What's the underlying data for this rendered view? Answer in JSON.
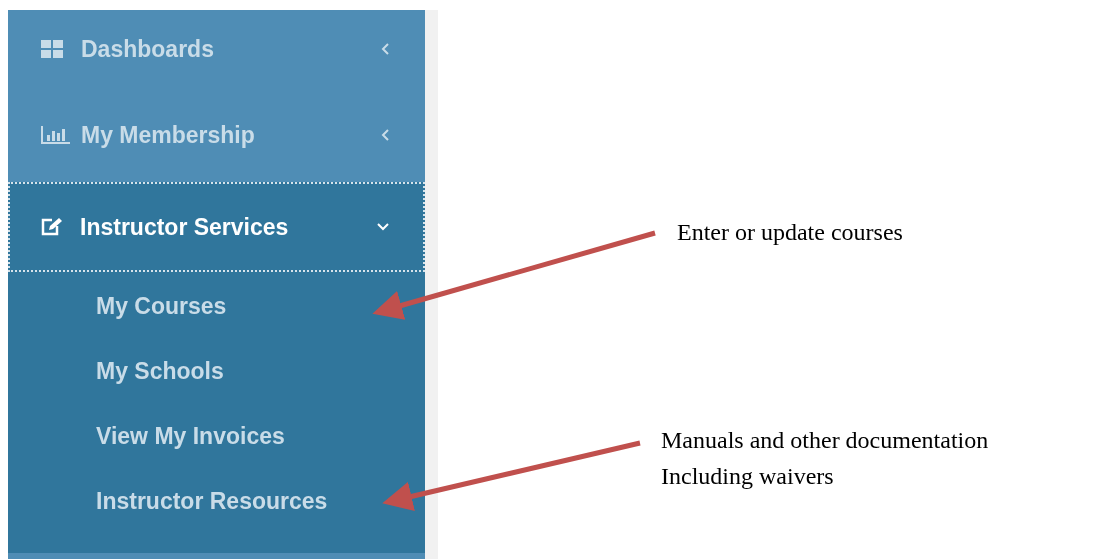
{
  "sidebar": {
    "items": [
      {
        "label": "Dashboards",
        "expanded": false,
        "selected": false
      },
      {
        "label": "My Membership",
        "expanded": false,
        "selected": false
      },
      {
        "label": "Instructor Services",
        "expanded": true,
        "selected": true,
        "children": [
          {
            "label": "My Courses"
          },
          {
            "label": "My Schools"
          },
          {
            "label": "View My Invoices"
          },
          {
            "label": "Instructor Resources"
          }
        ]
      }
    ]
  },
  "annotations": [
    {
      "lines": [
        "Enter or update courses"
      ]
    },
    {
      "lines": [
        "Manuals and other documentation",
        "Including waivers"
      ]
    }
  ]
}
